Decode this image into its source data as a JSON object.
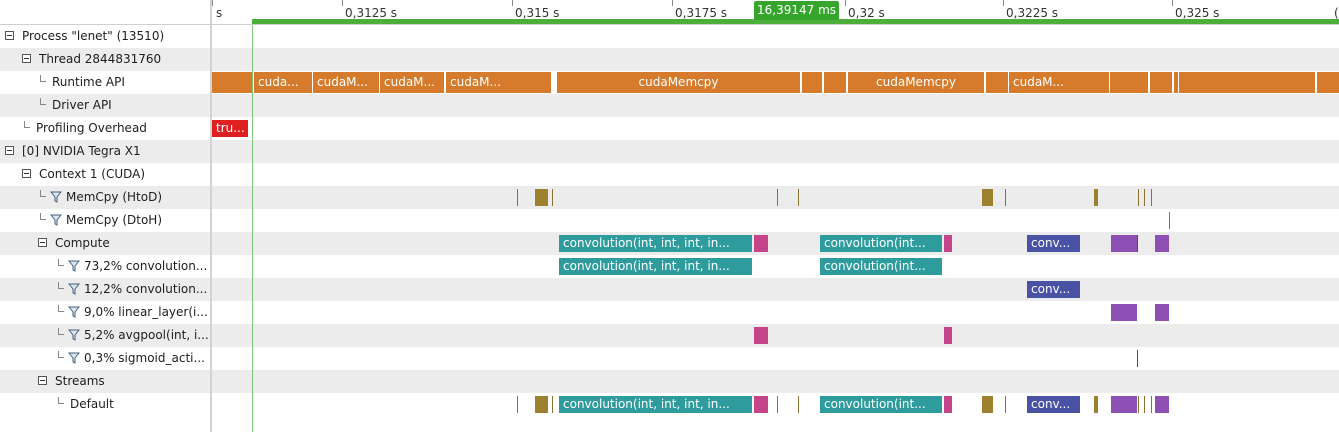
{
  "tree": {
    "rows": [
      {
        "label": "Process \"lenet\" (13510)",
        "kind": "expander",
        "indent": 0
      },
      {
        "label": "Thread 2844831760",
        "kind": "expander",
        "indent": 1
      },
      {
        "label": "Runtime API",
        "kind": "leaf",
        "indent": 2
      },
      {
        "label": "Driver API",
        "kind": "leaf",
        "indent": 2
      },
      {
        "label": "Profiling Overhead",
        "kind": "leaf",
        "indent": 1
      },
      {
        "label": "[0] NVIDIA Tegra X1",
        "kind": "expander",
        "indent": 0
      },
      {
        "label": "Context 1 (CUDA)",
        "kind": "expander",
        "indent": 1
      },
      {
        "label": "MemCpy (HtoD)",
        "kind": "filter",
        "indent": 2
      },
      {
        "label": "MemCpy (DtoH)",
        "kind": "filter",
        "indent": 2
      },
      {
        "label": "Compute",
        "kind": "expander",
        "indent": 2
      },
      {
        "label": "73,2% convolution...",
        "kind": "filter",
        "indent": 3
      },
      {
        "label": "12,2% convolution...",
        "kind": "filter",
        "indent": 3
      },
      {
        "label": "9,0% linear_layer(i...",
        "kind": "filter",
        "indent": 3
      },
      {
        "label": "5,2% avgpool(int, i...",
        "kind": "filter",
        "indent": 3
      },
      {
        "label": "0,3% sigmoid_acti...",
        "kind": "filter",
        "indent": 3
      },
      {
        "label": "Streams",
        "kind": "expander",
        "indent": 2
      },
      {
        "label": "Default",
        "kind": "leaf",
        "indent": 3
      }
    ]
  },
  "ruler": {
    "ticks": [
      {
        "label": "s"
      },
      {
        "label": "0,3125 s"
      },
      {
        "label": "0,315 s"
      },
      {
        "label": "0,3175 s"
      },
      {
        "label": "0,32 s"
      },
      {
        "label": "0,3225 s"
      },
      {
        "label": "0,325 s"
      },
      {
        "label": "("
      }
    ],
    "cursor_label": "16,39147 ms"
  },
  "timeline": {
    "runtime_api": [
      "cuda...",
      "cudaM...",
      "cudaM...",
      "cudaM...",
      "cudaMemcpy",
      "cudaMemcpy",
      "cudaM..."
    ],
    "overhead": [
      "tru..."
    ],
    "compute_labels": [
      "convolution(int, int, int, in...",
      "convolution(int...",
      "conv..."
    ]
  },
  "colors": {
    "runtime_api": "#d57b2b",
    "overhead": "#e02020",
    "memcpy": "#9e812e",
    "convolution_main": "#2e9c9c",
    "convolution_second": "#4a52a5",
    "linear_layer": "#8e50b4",
    "avgpool": "#c5448a",
    "range_bar": "#4caf3b"
  }
}
